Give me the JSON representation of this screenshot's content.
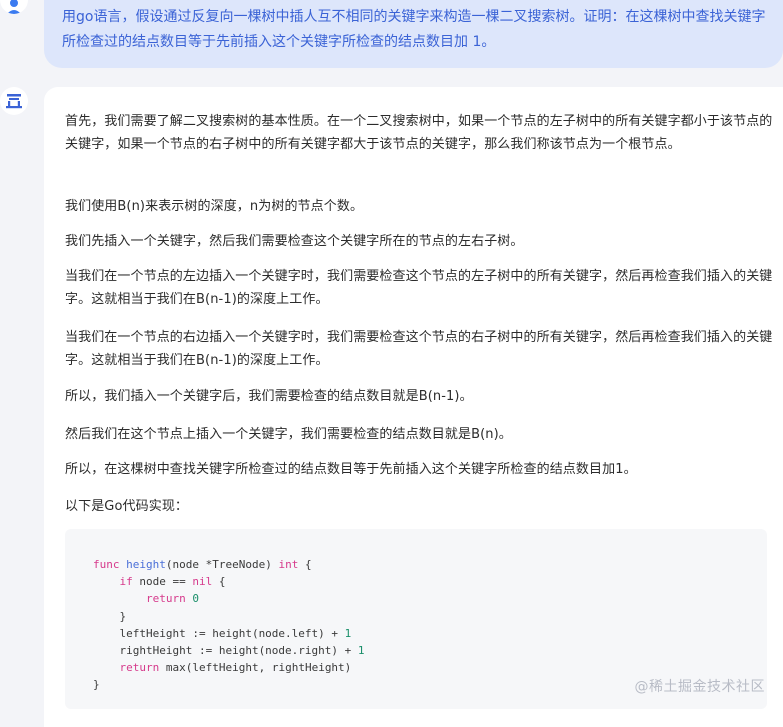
{
  "user_message": {
    "avatar_icon": "user-icon",
    "text": "用go语言，假设通过反复向一棵树中插人互不相同的关键字来构造一棵二叉搜索树。证明：在这棵树中查找关键字所检查过的结点数目等于先前插入这个关键字所检查的结点数目加 1。"
  },
  "answer": {
    "avatar_icon": "assistant-logo-icon",
    "paragraphs": [
      "首先，我们需要了解二叉搜索树的基本性质。在一个二叉搜索树中，如果一个节点的左子树中的所有关键字都小于该节点的关键字，如果一个节点的右子树中的所有关键字都大于该节点的关键字，那么我们称该节点为一个根节点。",
      "我们使用B(n)来表示树的深度，n为树的节点个数。",
      "我们先插入一个关键字，然后我们需要检查这个关键字所在的节点的左右子树。",
      "当我们在一个节点的左边插入一个关键字时，我们需要检查这个节点的左子树中的所有关键字，然后再检查我们插入的关键字。这就相当于我们在B(n-1)的深度上工作。",
      "当我们在一个节点的右边插入一个关键字时，我们需要检查这个节点的右子树中的所有关键字，然后再检查我们插入的关键字。这就相当于我们在B(n-1)的深度上工作。",
      "所以，我们插入一个关键字后，我们需要检查的结点数目就是B(n-1)。",
      "然后我们在这个节点上插入一个关键字，我们需要检查的结点数目就是B(n)。",
      "所以，在这棵树中查找关键字所检查过的结点数目等于先前插入这个关键字所检查的结点数目加1。",
      "以下是Go代码实现："
    ],
    "code_lines": [
      "func height(node *TreeNode) int {",
      "    if node == nil {",
      "        return 0",
      "    }",
      "    leftHeight := height(node.left) + 1",
      "    rightHeight := height(node.right) + 1",
      "    return max(leftHeight, rightHeight)",
      "}"
    ]
  },
  "watermark": "@稀土掘金技术社区",
  "colors": {
    "page_bg": "#f3f4f8",
    "user_bubble": "#dde6fb",
    "user_text": "#3b63d6",
    "keyword": "#d63a8c",
    "function": "#4a6fd8",
    "number": "#1a8f6a"
  }
}
